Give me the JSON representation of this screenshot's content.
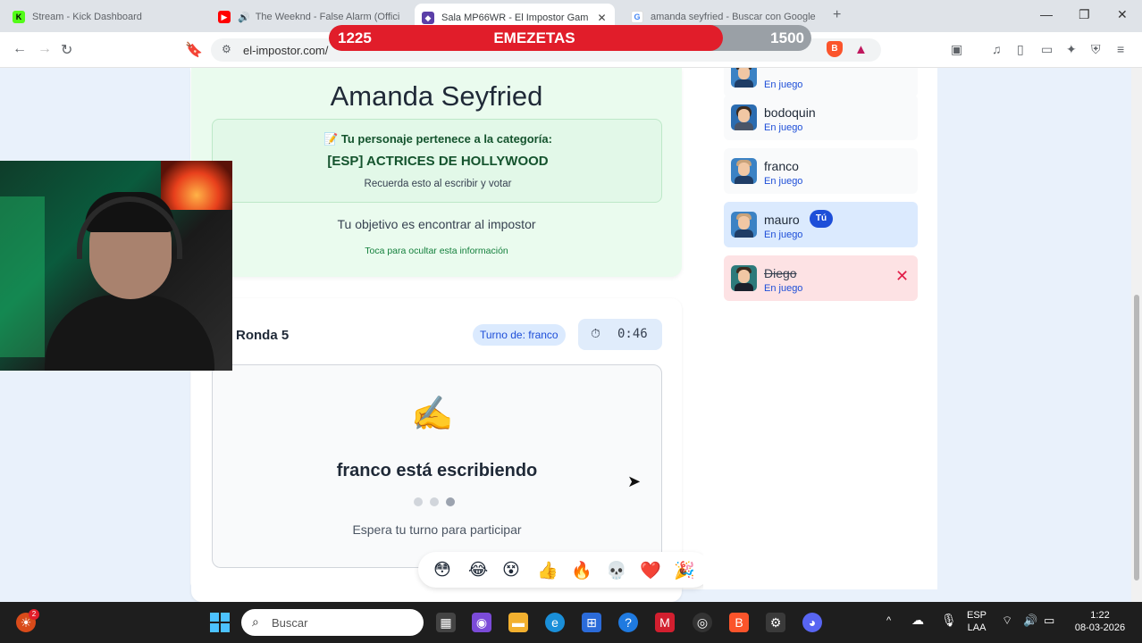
{
  "browser": {
    "tabs": [
      {
        "title": "Stream - Kick Dashboard",
        "active": false
      },
      {
        "title": "The Weeknd - False Alarm (Offici",
        "active": false
      },
      {
        "title": "Sala MP66WR - El Impostor Gam",
        "active": true
      },
      {
        "title": "amanda seyfried - Buscar con Google",
        "active": false
      }
    ],
    "url": "el-impostor.com/",
    "new_tab": "+"
  },
  "overlay": {
    "left_value": "1225",
    "name": "EMEZETAS",
    "right_value": "1500",
    "progress": 0.817,
    "color": "#e11d2a"
  },
  "game": {
    "character_name": "Amanda Seyfried",
    "category_label": "📝 Tu personaje pertenece a la categoría:",
    "category_value": "[ESP] ACTRICES DE HOLLYWOOD",
    "category_note": "Recuerda esto al escribir y votar",
    "objective": "Tu objetivo es encontrar al impostor",
    "hide_hint": "Toca para ocultar esta información",
    "round_title": "Ronda 5",
    "turn_label": "Turno de: franco",
    "timer_icon": "⏱",
    "timer": "0:46",
    "writing_icon": "✍️",
    "writing_text": "franco está escribiendo",
    "wait_text": "Espera tu turno para participar"
  },
  "reactions": [
    "😳",
    "😂",
    "😵",
    "👍",
    "🔥",
    "💀",
    "❤️",
    "🎉"
  ],
  "players": [
    {
      "name": "",
      "status": "En juego",
      "me": false,
      "eliminated": false
    },
    {
      "name": "bodoquin",
      "status": "En juego",
      "me": false,
      "eliminated": false
    },
    {
      "name": "franco",
      "status": "En juego",
      "me": false,
      "eliminated": false
    },
    {
      "name": "mauro",
      "status": "En juego",
      "me": true,
      "eliminated": false,
      "badge": "Tú"
    },
    {
      "name": "Diego",
      "status": "En juego",
      "me": false,
      "eliminated": true
    }
  ],
  "taskbar": {
    "search_placeholder": "Buscar",
    "lang_top": "ESP",
    "lang_bottom": "LAA",
    "time": "1:22",
    "date": "08-03-2026",
    "notif_count": "2"
  }
}
